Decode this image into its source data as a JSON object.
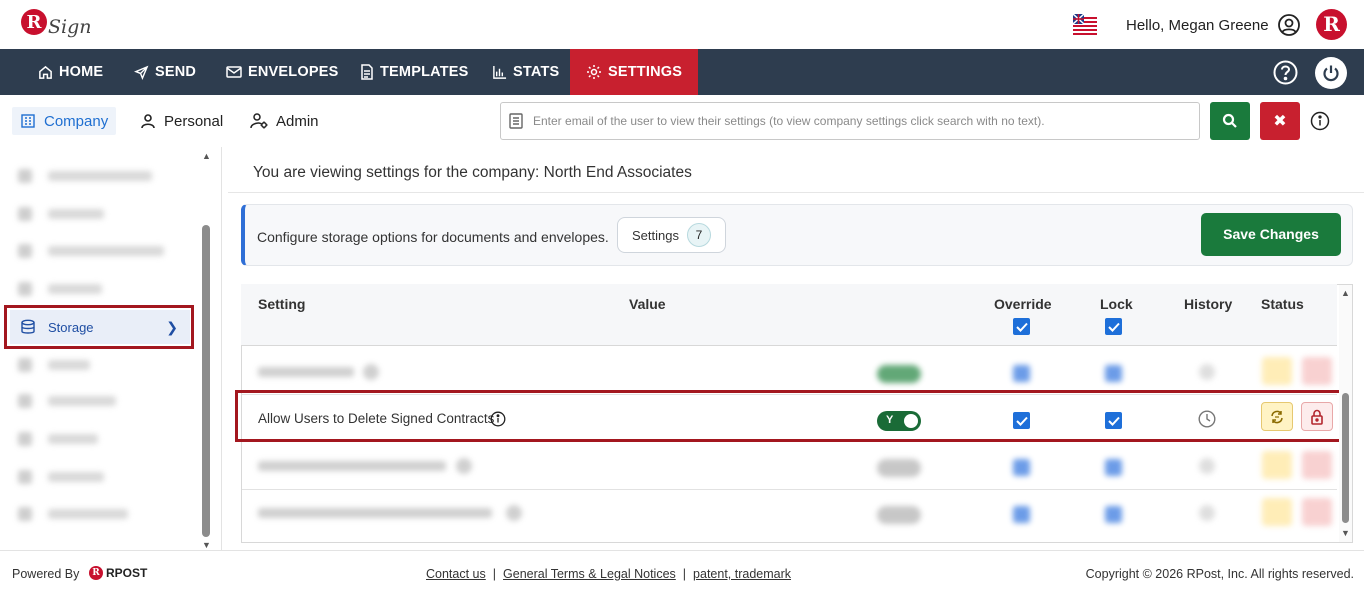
{
  "header": {
    "greeting": "Hello, Megan Greene",
    "avatar_initial": "R",
    "logo_text": "Sign",
    "logo_initial": "R",
    "brand_color": "#c8102e"
  },
  "nav": {
    "items": [
      {
        "label": "HOME",
        "icon": "home-icon"
      },
      {
        "label": "SEND",
        "icon": "send-icon"
      },
      {
        "label": "ENVELOPES",
        "icon": "envelope-icon"
      },
      {
        "label": "TEMPLATES",
        "icon": "template-icon"
      },
      {
        "label": "STATS",
        "icon": "stats-icon"
      },
      {
        "label": "SETTINGS",
        "icon": "gear-icon",
        "active": true
      }
    ],
    "bg_color": "#2e3d4f",
    "active_color": "#c8202f"
  },
  "subnav": {
    "tabs": [
      {
        "label": "Company",
        "active": true
      },
      {
        "label": "Personal"
      },
      {
        "label": "Admin"
      }
    ],
    "search_placeholder": "Enter email of the user to view their settings (to view company settings click search with no text).",
    "clear_label": "✖"
  },
  "sidebar": {
    "active_item": "Storage"
  },
  "main": {
    "title": "You are viewing settings for the company: North End Associates",
    "config_text": "Configure storage options for documents and envelopes.",
    "settings_label": "Settings",
    "settings_count": "7",
    "save_label": "Save Changes"
  },
  "table": {
    "headers": {
      "setting": "Setting",
      "value": "Value",
      "override": "Override",
      "lock": "Lock",
      "history": "History",
      "status": "Status"
    },
    "highlighted_row": {
      "label": "Allow Users to Delete Signed Contracts",
      "value": "Y",
      "override": true,
      "lock": true
    }
  },
  "footer": {
    "powered_by": "Powered By",
    "rpost": "RPOST",
    "links": [
      "Contact us",
      "General Terms & Legal Notices",
      "patent, trademark"
    ],
    "copyright": "Copyright © 2026 RPost, Inc. All rights reserved."
  }
}
